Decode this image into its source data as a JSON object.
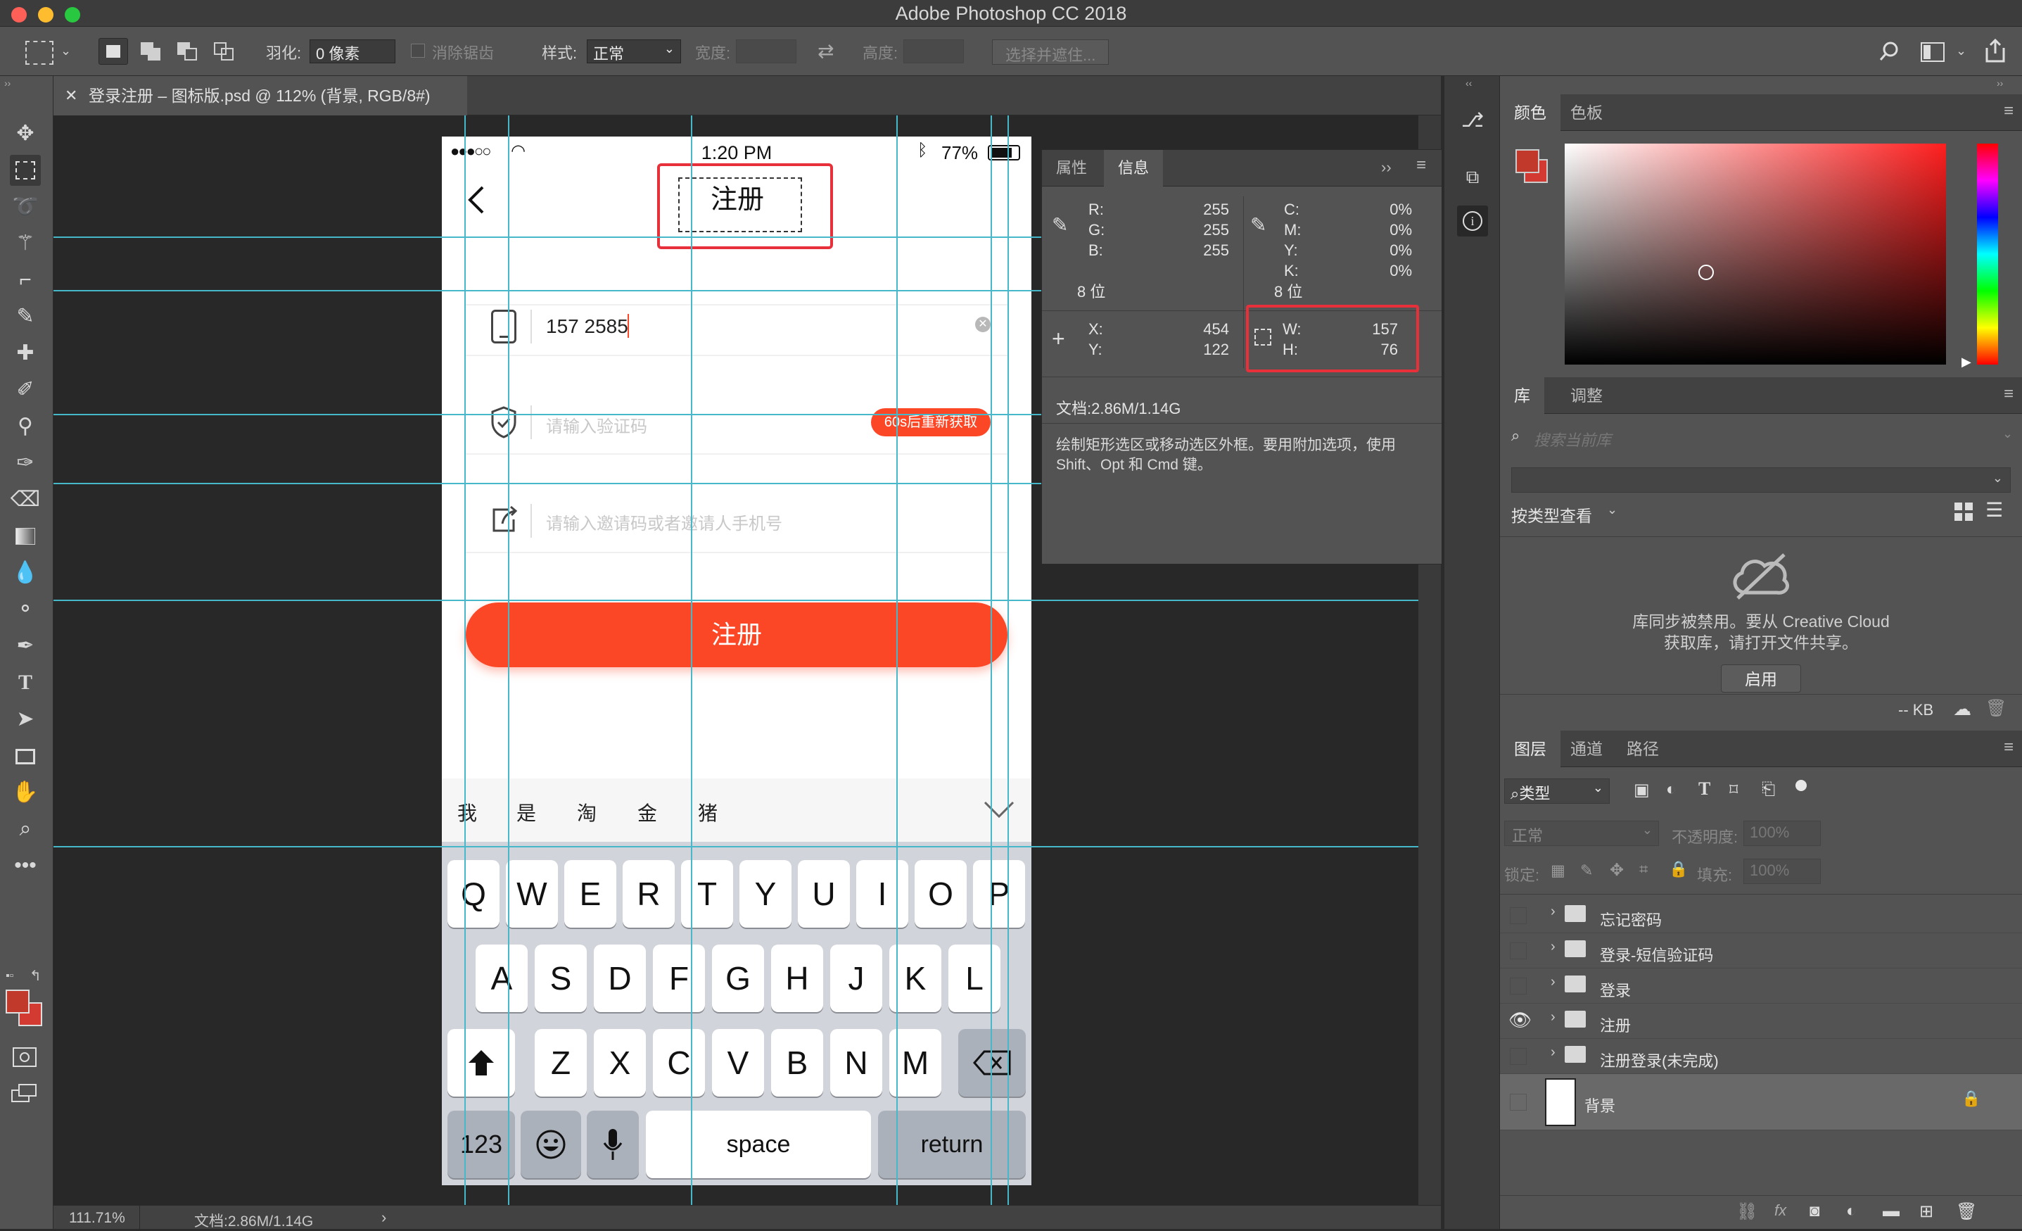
{
  "app": {
    "title": "Adobe Photoshop CC 2018"
  },
  "options": {
    "feather_label": "羽化:",
    "feather_value": "0 像素",
    "antialias_label": "消除锯齿",
    "style_label": "样式:",
    "style_value": "正常",
    "width_label": "宽度:",
    "height_label": "高度:",
    "select_mask_label": "选择并遮住..."
  },
  "document": {
    "tab_title": "登录注册 – 图标版.psd @ 112% (背景, RGB/8#)",
    "zoom": "111.71%",
    "doc_size": "文档:2.86M/1.14G"
  },
  "phone": {
    "status_time": "1:20 PM",
    "battery": "77%",
    "page_title": "注册",
    "phone_value": "157 2585",
    "code_placeholder": "请输入验证码",
    "resend_label": "60s后重新获取",
    "invite_placeholder": "请输入邀请码或者邀请人手机号",
    "register_button": "注册",
    "candidates": [
      "我",
      "是",
      "淘",
      "金",
      "猪"
    ],
    "keyboard": {
      "row1": [
        "Q",
        "W",
        "E",
        "R",
        "T",
        "Y",
        "U",
        "I",
        "O",
        "P"
      ],
      "row2": [
        "A",
        "S",
        "D",
        "F",
        "G",
        "H",
        "J",
        "K",
        "L"
      ],
      "row3": [
        "Z",
        "X",
        "C",
        "V",
        "B",
        "N",
        "M"
      ],
      "num_key": "123",
      "space_key": "space",
      "return_key": "return"
    }
  },
  "info_panel": {
    "tab_properties": "属性",
    "tab_info": "信息",
    "rgb_labels": [
      "R:",
      "G:",
      "B:"
    ],
    "rgb_values": [
      "255",
      "255",
      "255"
    ],
    "bit_depth_left": "8 位",
    "cmyk_labels": [
      "C:",
      "M:",
      "Y:",
      "K:"
    ],
    "cmyk_values": [
      "0%",
      "0%",
      "0%",
      "0%"
    ],
    "bit_depth_right": "8 位",
    "x_label": "X:",
    "y_label": "Y:",
    "x_value": "454",
    "y_value": "122",
    "w_label": "W:",
    "h_label": "H:",
    "w_value": "157",
    "h_value": "76",
    "doc_size": "文档:2.86M/1.14G",
    "hint": "绘制矩形选区或移动选区外框。要用附加选项，使用 Shift、Opt 和 Cmd 键。"
  },
  "color_panel": {
    "tab_color": "颜色",
    "tab_swatches": "色板"
  },
  "library_panel": {
    "tab_library": "库",
    "tab_adjust": "调整",
    "search_placeholder": "搜索当前库",
    "view_by_type": "按类型查看",
    "sync_message_line1": "库同步被禁用。要从 Creative Cloud",
    "sync_message_line2": "获取库，请打开文件共享。",
    "enable_button": "启用",
    "size": "-- KB"
  },
  "layers_panel": {
    "tab_layers": "图层",
    "tab_channels": "通道",
    "tab_paths": "路径",
    "filter_type": "类型",
    "blend_mode": "正常",
    "opacity_label": "不透明度:",
    "opacity_value": "100%",
    "lock_label": "锁定:",
    "fill_label": "填充:",
    "fill_value": "100%",
    "layers": [
      {
        "name": "忘记密码",
        "visible": false
      },
      {
        "name": "登录-短信验证码",
        "visible": false
      },
      {
        "name": "登录",
        "visible": false
      },
      {
        "name": "注册",
        "visible": true
      },
      {
        "name": "注册登录(未完成)",
        "visible": false
      }
    ],
    "background_layer": "背景"
  },
  "colors": {
    "accent_red": "#fc4727",
    "selection_red": "#e8303a",
    "guide": "#47b8c9",
    "fg_swatch": "#c0392b"
  }
}
